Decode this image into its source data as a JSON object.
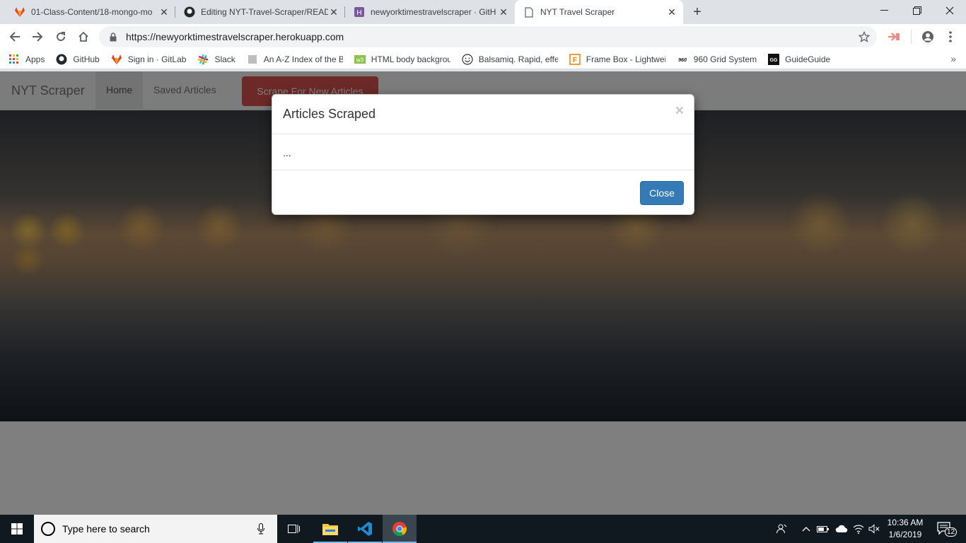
{
  "browser": {
    "tabs": [
      {
        "title": "01-Class-Content/18-mongo-mo",
        "icon": "gitlab-icon"
      },
      {
        "title": "Editing NYT-Travel-Scraper/READ",
        "icon": "github-icon"
      },
      {
        "title": "newyorktimestravelscraper · GitH",
        "icon": "heroku-icon"
      },
      {
        "title": "NYT Travel Scraper",
        "icon": "page-icon"
      }
    ],
    "url": "https://newyorktimestravelscraper.herokuapp.com",
    "bookmarks": [
      {
        "label": "Apps",
        "icon": "apps-grid-icon"
      },
      {
        "label": "GitHub",
        "icon": "github-icon"
      },
      {
        "label": "Sign in · GitLab",
        "icon": "gitlab-icon"
      },
      {
        "label": "Slack",
        "icon": "slack-icon"
      },
      {
        "label": "An A-Z Index of the B",
        "icon": "page-icon"
      },
      {
        "label": "HTML body backgrou",
        "icon": "w3-icon"
      },
      {
        "label": "Balsamiq. Rapid, effe",
        "icon": "smiley-icon"
      },
      {
        "label": "Frame Box - Lightwei",
        "icon": "framebox-icon"
      },
      {
        "label": "960 Grid System",
        "icon": "960-icon"
      },
      {
        "label": "GuideGuide",
        "icon": "guideguide-icon"
      }
    ],
    "bookmarks_more": "»"
  },
  "page": {
    "brand": "NYT Scraper",
    "nav": {
      "home": "Home",
      "saved": "Saved Articles"
    },
    "scrape_button": "Scrape For New Articles"
  },
  "modal": {
    "title": "Articles Scraped",
    "close_symbol": "×",
    "body": "...",
    "close_button": "Close"
  },
  "taskbar": {
    "search_placeholder": "Type here to search",
    "time": "10:36 AM",
    "date": "1/6/2019",
    "notifications": "12"
  },
  "colors": {
    "scrape_button": "#d9534f",
    "close_button": "#337ab7",
    "taskbar": "#101820"
  }
}
